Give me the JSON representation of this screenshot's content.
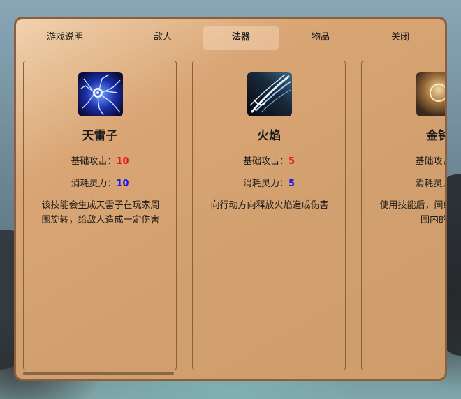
{
  "tabs": [
    {
      "label": "游戏说明",
      "active": false
    },
    {
      "label": "敌人",
      "active": false
    },
    {
      "label": "法器",
      "active": true
    },
    {
      "label": "物品",
      "active": false
    },
    {
      "label": "关闭",
      "active": false
    }
  ],
  "cards": [
    {
      "name": "天雷子",
      "icon": "lightning-orb-icon",
      "attack_label": "基础攻击：",
      "attack_value": "10",
      "cost_label": "消耗灵力：",
      "cost_value": "10",
      "description": "该技能会生成天雷子在玩家周围旋转，给敌人造成一定伤害"
    },
    {
      "name": "火焰",
      "icon": "flame-slash-icon",
      "attack_label": "基础攻击：",
      "attack_value": "5",
      "cost_label": "消耗灵力：",
      "cost_value": "5",
      "description": "向行动方向释放火焰造成伤害"
    },
    {
      "name": "金钟",
      "icon": "golden-bell-icon",
      "attack_label": "基础攻击：",
      "attack_value": "",
      "cost_label": "消耗灵力：",
      "cost_value": "",
      "description": "使用技能后，间结束后发生范围内的敌"
    }
  ],
  "colors": {
    "panel_border": "#8b5e3c",
    "attack_value": "#e8141a",
    "cost_value": "#1a1ae8"
  }
}
